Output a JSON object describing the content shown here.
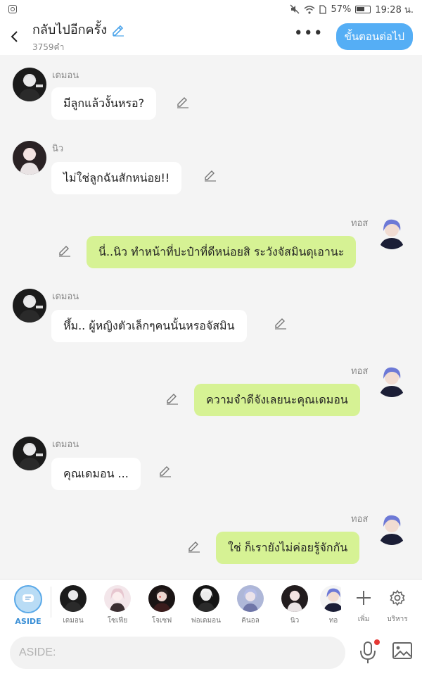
{
  "status_bar": {
    "battery": "57%",
    "time": "19:28 น."
  },
  "header": {
    "title": "กลับไปอีกครั้ง",
    "word_count": "3759คำ",
    "next_label": "ขั้นตอนต่อไป"
  },
  "messages": [
    {
      "speaker": "เดมอน",
      "text": "มีลูกแล้วงั้นหรอ?",
      "side": "left"
    },
    {
      "speaker": "นิว",
      "text": "ไม่ใช่ลูกฉันสักหน่อย!!",
      "side": "left"
    },
    {
      "speaker": "ทอส",
      "text": "นี่..นิว ทำหน้าที่ปะป๋าที่ดีหน่อยสิ ระวังจัสมินดุเอานะ",
      "side": "right"
    },
    {
      "speaker": "เดมอน",
      "text": "หึ้ม.. ผู้หญิงตัวเล็กๆคนนั้นหรอจัสมิน",
      "side": "left"
    },
    {
      "speaker": "ทอส",
      "text": "ความจำดีจังเลยนะคุณเดมอน",
      "side": "right"
    },
    {
      "speaker": "เดมอน",
      "text": "คุณเดมอน ...",
      "side": "left"
    },
    {
      "speaker": "ทอส",
      "text": "ใช่ ก็เรายังไม่ค่อยรู้จักกัน",
      "side": "right"
    }
  ],
  "characters": {
    "aside_label": "ASIDE",
    "items": [
      {
        "label": "เดมอน"
      },
      {
        "label": "โซเฟีย"
      },
      {
        "label": "โจเซฟ"
      },
      {
        "label": "พ่อเดมอน"
      },
      {
        "label": "คินอล"
      },
      {
        "label": "นิว"
      },
      {
        "label": "ทอ"
      }
    ],
    "add_label": "เพิ่ม",
    "manage_label": "บริหาร"
  },
  "input": {
    "placeholder": "ASIDE:"
  },
  "colors": {
    "accent": "#55aef5",
    "bubble_right": "#d6f294",
    "bubble_left": "#ffffff"
  }
}
